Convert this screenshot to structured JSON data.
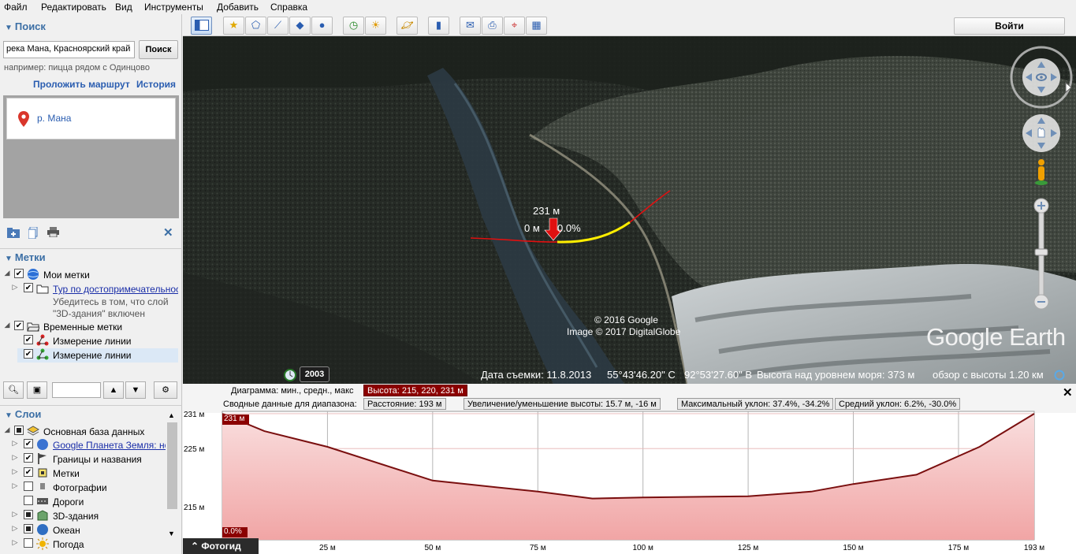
{
  "menu": [
    "Файл",
    "Редактировать",
    "Вид",
    "Инструменты",
    "Добавить",
    "Справка"
  ],
  "search": {
    "title": "Поиск",
    "query": "река Мана, Красноярский край",
    "button": "Поиск",
    "hint": "например: пицца рядом с Одинцово",
    "route_link": "Проложить маршрут",
    "history_link": "История",
    "result": "р. Мана"
  },
  "places": {
    "title": "Метки",
    "items": [
      {
        "label": "Мои метки",
        "style": "normal"
      },
      {
        "label": "Тур по достопримечательностям",
        "style": "link"
      },
      {
        "label": "Убедитесь в том, что слой",
        "style": "grey"
      },
      {
        "label": "\"3D-здания\" включен",
        "style": "grey"
      },
      {
        "label": "Временные метки",
        "style": "normal"
      },
      {
        "label": "Измерение линии",
        "style": "normal"
      },
      {
        "label": "Измерение линии",
        "style": "normal"
      }
    ]
  },
  "layers": {
    "title": "Слои",
    "items": [
      {
        "label": "Основная база данных",
        "style": "normal"
      },
      {
        "label": "Google Планета Земля: новое",
        "style": "link"
      },
      {
        "label": "Границы и названия",
        "style": "normal"
      },
      {
        "label": "Метки",
        "style": "normal"
      },
      {
        "label": "Фотографии",
        "style": "normal"
      },
      {
        "label": "Дороги",
        "style": "normal"
      },
      {
        "label": "3D-здания",
        "style": "normal"
      },
      {
        "label": "Океан",
        "style": "normal"
      },
      {
        "label": "Погода",
        "style": "normal"
      }
    ]
  },
  "toolbar": {
    "signin": "Войти"
  },
  "map": {
    "elevation_label": "231 м",
    "distance_label": "0 м",
    "slope_label": "0.0%",
    "copyright1": "© 2016 Google",
    "copyright2": "Image © 2017 DigitalGlobe",
    "logo": "Google Earth",
    "year": "2003",
    "status": {
      "date": "Дата съемки: 11.8.2013",
      "lat": "55°43'46.20\" С",
      "lon": "92°53'27.60\" В",
      "elev": "Высота над уровнем моря:   373 м",
      "eye": "обзор с высоты    1.20 км"
    }
  },
  "profile": {
    "diagram_label": "Диаграмма: мин., средн., макс",
    "height_box": "Высота: 215, 220, 231 м",
    "range_label": "Сводные данные для диапазона:",
    "distance_box": "Расстояние: 193 м",
    "gain_box": "Увеличение/уменьшение высоты: 15.7 м, -16 м",
    "max_slope_box": "Максимальный уклон: 37.4%, -34.2%",
    "avg_slope_box": "Средний уклон: 6.2%, -30.0%",
    "cursor_value": "231 м",
    "cursor_slope": "0.0%",
    "fotogid": "Фотогид"
  },
  "chart_data": {
    "type": "area",
    "x": [
      0,
      10,
      25,
      50,
      75,
      88,
      100,
      125,
      140,
      150,
      165,
      180,
      193
    ],
    "y": [
      231,
      228,
      225.3,
      219.5,
      217.6,
      216.4,
      216.6,
      216.8,
      217.6,
      218.9,
      220.5,
      225.3,
      231
    ],
    "x_ticks": [
      "25 м",
      "50 м",
      "75 м",
      "100 м",
      "125 м",
      "150 м",
      "175 м",
      "193 м"
    ],
    "x_tick_values": [
      25,
      50,
      75,
      100,
      125,
      150,
      175,
      193
    ],
    "y_ticks": [
      "231 м",
      "225 м",
      "215 м"
    ],
    "y_tick_values": [
      231,
      225,
      215
    ],
    "xlim": [
      0,
      193
    ],
    "ylim": [
      209.3,
      231.4
    ],
    "line_color": "#7a0f0f",
    "fill_top": "#f9dede",
    "fill_bottom": "#f1a5a5"
  }
}
